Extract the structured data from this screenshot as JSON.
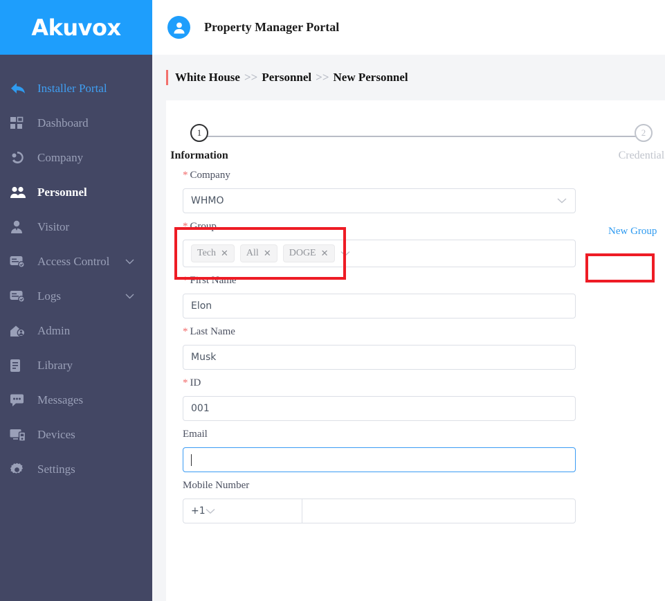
{
  "sidebar": {
    "logo": "Akuvox",
    "items": [
      {
        "label": "Installer Portal",
        "icon": "back-arrow-icon",
        "state": "link"
      },
      {
        "label": "Dashboard",
        "icon": "dashboard-grid-icon",
        "state": "normal"
      },
      {
        "label": "Company",
        "icon": "company-icon",
        "state": "normal"
      },
      {
        "label": "Personnel",
        "icon": "personnel-people-icon",
        "state": "active"
      },
      {
        "label": "Visitor",
        "icon": "visitor-person-icon",
        "state": "normal"
      },
      {
        "label": "Access Control",
        "icon": "access-card-icon",
        "state": "normal",
        "expandable": true
      },
      {
        "label": "Logs",
        "icon": "logs-card-icon",
        "state": "normal",
        "expandable": true
      },
      {
        "label": "Admin",
        "icon": "admin-house-icon",
        "state": "normal"
      },
      {
        "label": "Library",
        "icon": "library-book-icon",
        "state": "normal"
      },
      {
        "label": "Messages",
        "icon": "messages-bubble-icon",
        "state": "normal"
      },
      {
        "label": "Devices",
        "icon": "devices-monitor-icon",
        "state": "normal"
      },
      {
        "label": "Settings",
        "icon": "settings-gear-icon",
        "state": "normal"
      }
    ]
  },
  "header": {
    "portal_title": "Property Manager Portal",
    "avatar_icon": "user-avatar-icon"
  },
  "breadcrumb": {
    "items": [
      "White House",
      "Personnel",
      "New Personnel"
    ],
    "separator": ">>"
  },
  "stepper": {
    "steps": [
      {
        "number": "1",
        "label": "Information",
        "active": true
      },
      {
        "number": "2",
        "label": "Credentials",
        "active": false
      }
    ]
  },
  "form": {
    "company": {
      "label": "Company",
      "required": true,
      "value": "WHMO",
      "chevron_icon": "chevron-down-icon"
    },
    "group": {
      "label": "Group",
      "required": true,
      "tags": [
        "Tech",
        "All",
        "DOGE"
      ],
      "tag_remove_icon": "close-x-icon",
      "chevron_icon": "chevron-down-icon",
      "new_group_label": "New Group"
    },
    "first_name": {
      "label": "First Name",
      "required": true,
      "value": "Elon"
    },
    "last_name": {
      "label": "Last Name",
      "required": true,
      "value": "Musk"
    },
    "id": {
      "label": "ID",
      "required": true,
      "value": "001"
    },
    "email": {
      "label": "Email",
      "required": false,
      "value": "",
      "focused": true
    },
    "mobile": {
      "label": "Mobile Number",
      "required": false,
      "country_code": "+1",
      "number": "",
      "chevron_icon": "chevron-down-icon"
    },
    "required_marker": "*"
  },
  "colors": {
    "brand_blue": "#1e9efc",
    "sidebar": "#434764",
    "link_blue": "#2f9bf0",
    "required_red": "#f26b6b",
    "highlight_red": "#ee1c25",
    "accent_salmon": "#f2706c"
  }
}
